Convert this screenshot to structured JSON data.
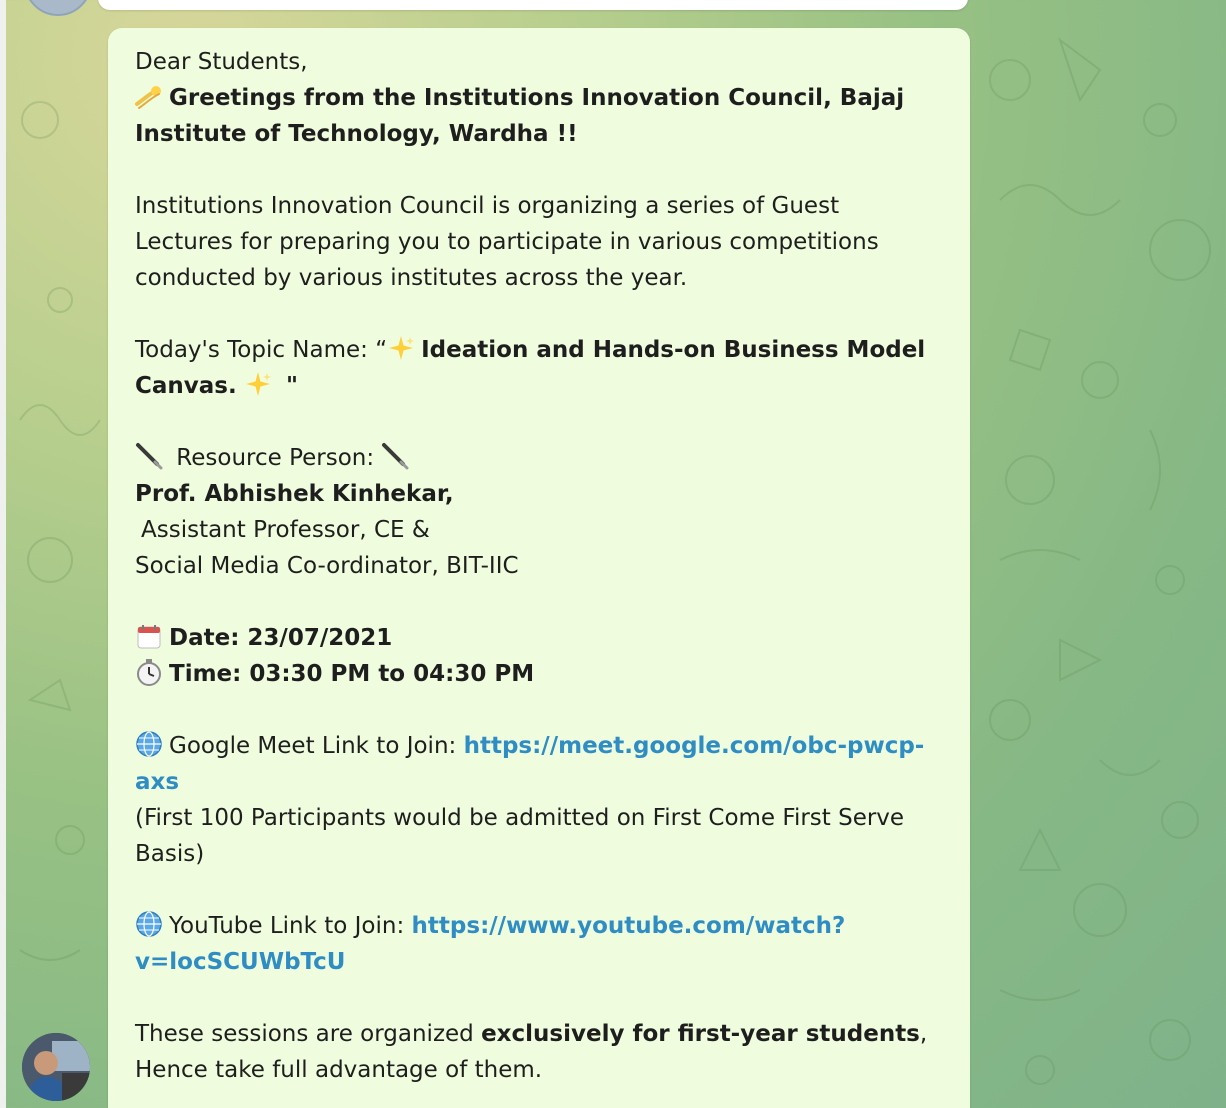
{
  "message": {
    "greeting": "Dear Students,",
    "headline_part1": "Greetings from the Institutions Innovation Council, Bajaj",
    "headline_part2": "Institute of Technology, Wardha !!",
    "intro_line1": "Institutions Innovation Council is organizing a series of Guest",
    "intro_line2": "Lectures for preparing you to participate in various competitions",
    "intro_line3": "conducted by various institutes across the year.",
    "topic_label": "Today's Topic Name: “",
    "topic_title_part1": "Ideation and Hands-on Business Model",
    "topic_title_part2": "Canvas.",
    "topic_close": " \"",
    "resource_label": " Resource Person: ",
    "resource_name": "Prof. Abhishek Kinhekar,",
    "resource_title1": "Assistant Professor, CE &",
    "resource_title2": "Social Media Co-ordinator, BIT-IIC",
    "date_text": "Date: 23/07/2021",
    "time_text": "Time: 03:30 PM to 04:30 PM",
    "meet_label": "Google Meet Link to Join: ",
    "meet_url_part1": "https://meet.google.com/obc-pwcp-",
    "meet_url_part2": "axs",
    "meet_note1": "(First 100 Participants would be admitted on First Come First Serve",
    "meet_note2": "Basis)",
    "youtube_label": "YouTube Link to Join: ",
    "youtube_url_part1": "https://www.youtube.com/watch?",
    "youtube_url_part2": "v=locSCUWbTcU",
    "closing1_pre": "These sessions are organized ",
    "closing1_bold": "exclusively for first-year students",
    "closing1_post": ",",
    "closing2": "Hence take full advantage of them."
  },
  "icons": {
    "comet": "comet-icon",
    "sparkles": "sparkles-icon",
    "pen": "pen-icon",
    "calendar": "calendar-icon",
    "stopwatch": "stopwatch-icon",
    "globe": "globe-icon"
  },
  "colors": {
    "bubble": "#effdde",
    "link": "#2f8dc4",
    "text": "#1e1e1e"
  }
}
